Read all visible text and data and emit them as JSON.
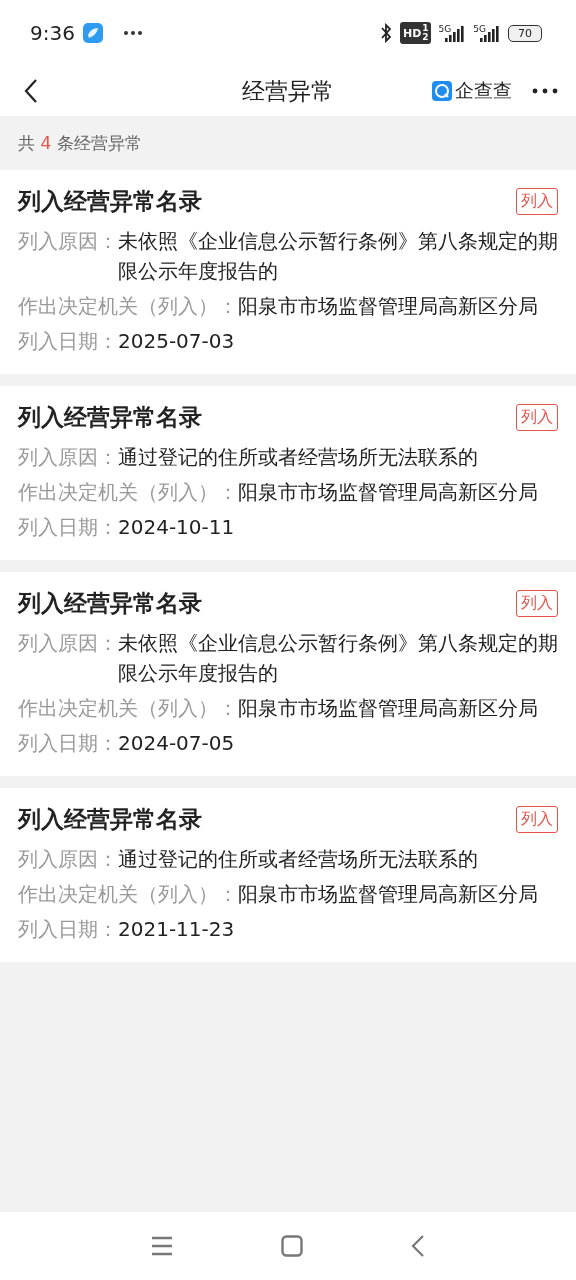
{
  "status_bar": {
    "time": "9:36",
    "hd": "HD",
    "hd_sup": "1",
    "hd_sub": "2",
    "network_1": "5G",
    "network_2": "5G",
    "battery": "70"
  },
  "header": {
    "title": "经营异常",
    "brand": "企查查"
  },
  "summary": {
    "prefix": "共",
    "count": "4",
    "suffix": "条经营异常"
  },
  "records": [
    {
      "title": "列入经营异常名录",
      "tag": "列入",
      "fields": [
        {
          "label": "列入原因：",
          "value": "未依照《企业信息公示暂行条例》第八条规定的期限公示年度报告的"
        },
        {
          "label": "作出决定机关（列入）：",
          "value": "阳泉市市场监督管理局高新区分局"
        },
        {
          "label": "列入日期：",
          "value": "2025-07-03"
        }
      ]
    },
    {
      "title": "列入经营异常名录",
      "tag": "列入",
      "fields": [
        {
          "label": "列入原因：",
          "value": "通过登记的住所或者经营场所无法联系的"
        },
        {
          "label": "作出决定机关（列入）：",
          "value": "阳泉市市场监督管理局高新区分局"
        },
        {
          "label": "列入日期：",
          "value": "2024-10-11"
        }
      ]
    },
    {
      "title": "列入经营异常名录",
      "tag": "列入",
      "fields": [
        {
          "label": "列入原因：",
          "value": "未依照《企业信息公示暂行条例》第八条规定的期限公示年度报告的"
        },
        {
          "label": "作出决定机关（列入）：",
          "value": "阳泉市市场监督管理局高新区分局"
        },
        {
          "label": "列入日期：",
          "value": "2024-07-05"
        }
      ]
    },
    {
      "title": "列入经营异常名录",
      "tag": "列入",
      "fields": [
        {
          "label": "列入原因：",
          "value": "通过登记的住所或者经营场所无法联系的"
        },
        {
          "label": "作出决定机关（列入）：",
          "value": "阳泉市市场监督管理局高新区分局"
        },
        {
          "label": "列入日期：",
          "value": "2021-11-23"
        }
      ]
    }
  ]
}
